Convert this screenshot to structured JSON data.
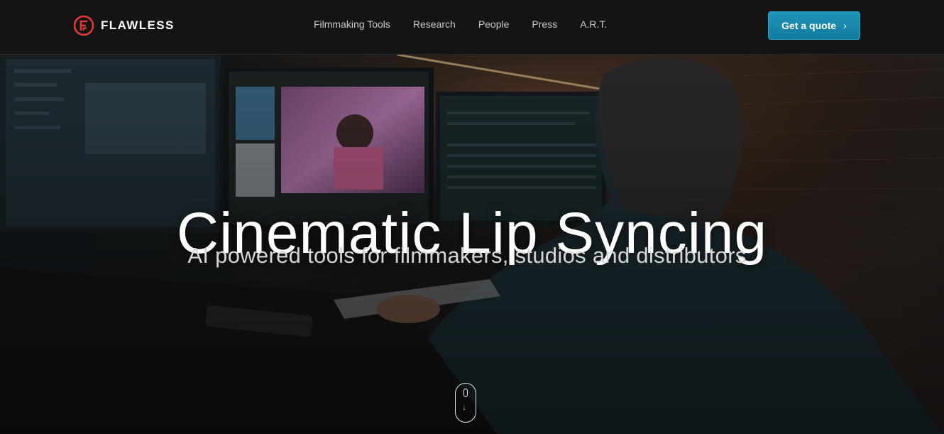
{
  "header": {
    "brand": "FLAWLESS",
    "nav": [
      {
        "label": "Filmmaking Tools"
      },
      {
        "label": "Research"
      },
      {
        "label": "People"
      },
      {
        "label": "Press"
      },
      {
        "label": "A.R.T."
      }
    ],
    "cta_label": "Get a quote",
    "cta_icon": "chevron-right-icon"
  },
  "hero": {
    "title": "Cinematic Lip Syncing",
    "subtitle": "AI powered tools for filmmakers, studios and distributors",
    "scroll_icon": "mouse-scroll-icon"
  },
  "colors": {
    "accent": "#1a8cb0",
    "logo_red": "#e03a3a",
    "nav_bg": "#141414"
  }
}
